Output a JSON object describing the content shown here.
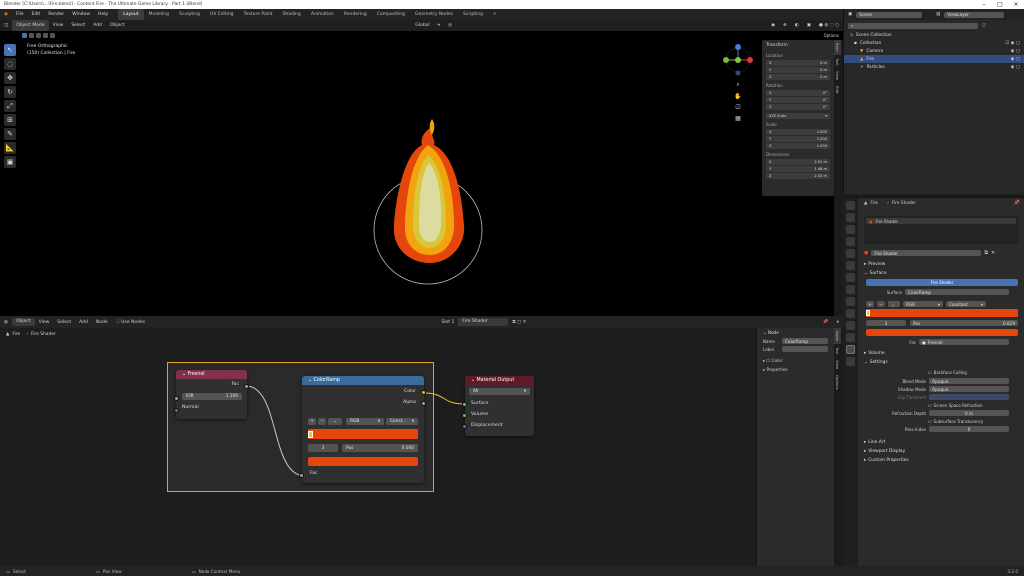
{
  "titlebar": {
    "title": "Blender [C:\\Users\\...\\Fire.blend] - Content Fire - The Ultimate Game Library - Part 1 (Blend)"
  },
  "menu": {
    "items": [
      "File",
      "Edit",
      "Render",
      "Window",
      "Help"
    ],
    "workspaces": [
      "Layout",
      "Modeling",
      "Sculpting",
      "UV Editing",
      "Texture Paint",
      "Shading",
      "Animation",
      "Rendering",
      "Compositing",
      "Geometry Nodes",
      "Scripting"
    ],
    "scene_label": "Scene",
    "viewlayer_label": "ViewLayer"
  },
  "viewport": {
    "mode": "Object Mode",
    "menus": [
      "View",
      "Select",
      "Add",
      "Object"
    ],
    "transform_orient": "Global",
    "view_name": "Free Orthographic",
    "view_info": "(150) Collection | Fire",
    "options_label": "Options"
  },
  "npanel": {
    "header": "Transform",
    "location_label": "Location",
    "location": [
      {
        "axis": "X",
        "value": "0 m"
      },
      {
        "axis": "Y",
        "value": "0 m"
      },
      {
        "axis": "Z",
        "value": "0 m"
      }
    ],
    "rotation_label": "Rotation",
    "rotation": [
      {
        "axis": "X",
        "value": "0°"
      },
      {
        "axis": "Y",
        "value": "0°"
      },
      {
        "axis": "Z",
        "value": "0°"
      }
    ],
    "rot_mode": "XYZ Euler",
    "scale_label": "Scale",
    "scale": [
      {
        "axis": "X",
        "value": "1.000"
      },
      {
        "axis": "Y",
        "value": "1.000"
      },
      {
        "axis": "Z",
        "value": "1.000"
      }
    ],
    "dims_label": "Dimensions",
    "dims": [
      {
        "axis": "X",
        "value": "2.91 m"
      },
      {
        "axis": "Y",
        "value": "1.48 m"
      },
      {
        "axis": "Z",
        "value": "2.02 m"
      }
    ],
    "tabs": [
      "Item",
      "Tool",
      "View",
      "Edit"
    ]
  },
  "node_editor": {
    "type": "Object",
    "menus": [
      "View",
      "Select",
      "Add",
      "Node"
    ],
    "use_nodes": "Use Nodes",
    "slot": "Slot 1",
    "material": "Fire Shader",
    "breadcrumb": [
      "Fire",
      "Fire Shader"
    ],
    "fresnel": {
      "title": "Fresnel",
      "out": "Fac",
      "ior_label": "IOR",
      "ior_value": "1.100",
      "normal": "Normal"
    },
    "colorramp": {
      "title": "ColorRamp",
      "out_color": "Color",
      "out_alpha": "Alpha",
      "mode": "RGB",
      "interp": "Const...",
      "index": "3",
      "pos_label": "Pos",
      "pos_value": "0.000",
      "in_fac": "Fac"
    },
    "output": {
      "title": "Material Output",
      "target": "All",
      "surface": "Surface",
      "volume": "Volume",
      "displacement": "Displacement"
    },
    "sidebar": {
      "header": "Node",
      "name_label": "Name",
      "name_value": "ColorRamp",
      "label_label": "Label",
      "color_label": "Color",
      "properties": "Properties",
      "tabs": [
        "Node",
        "Tool",
        "View",
        "Options"
      ]
    }
  },
  "outliner": {
    "root": "Scene Collection",
    "items": [
      {
        "name": "Collection",
        "indent": 1
      },
      {
        "name": "Camera",
        "indent": 2
      },
      {
        "name": "Fire",
        "indent": 2
      },
      {
        "name": "Particles",
        "indent": 2
      }
    ]
  },
  "properties": {
    "object": "Fire",
    "material": "Fire Shader",
    "slot_item": "Fire Shader",
    "material_field": "Fire Shader",
    "preview": "Preview",
    "surface": "Surface",
    "surface_shader": "Fire Shader",
    "surface_label": "Surface",
    "surface_value": "ColorRamp",
    "cr_mode": "RGB",
    "cr_interp": "Constant",
    "cr_index": "3",
    "cr_pos_label": "Pos",
    "cr_pos_value": "0.829",
    "fac_label": "Fac",
    "fac_value": "Fresnel",
    "volume": "Volume",
    "settings": "Settings",
    "backface": "Backface Culling",
    "blend_label": "Blend Mode",
    "blend_value": "Opaque",
    "shadow_label": "Shadow Mode",
    "shadow_value": "Opaque",
    "clip_label": "Clip Threshold",
    "ssr": "Screen Space Refraction",
    "refr_label": "Refraction Depth",
    "refr_value": "0 m",
    "sst": "Subsurface Translucency",
    "pass_label": "Pass Index",
    "pass_value": "0",
    "lineart": "Line Art",
    "viewport_display": "Viewport Display",
    "custom_props": "Custom Properties"
  },
  "statusbar": {
    "select": "Select",
    "pan": "Pan View",
    "ctx": "Node Context Menu",
    "version": "3.2.0"
  },
  "colors": {
    "accent": "#4772b3",
    "fire_orange": "#e5460c",
    "frame": "#e0a231",
    "fresnel_head": "#83314a",
    "ramp_head": "#3b6b9c",
    "output_head": "#5e1d26"
  }
}
